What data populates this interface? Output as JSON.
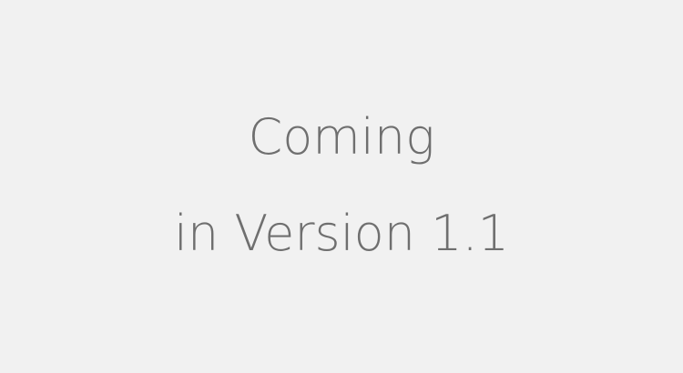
{
  "placeholder": {
    "line1": "Coming",
    "line2": "in Version 1.1"
  },
  "colors": {
    "background": "#f1f1f1",
    "text": "#6f6f6f"
  }
}
